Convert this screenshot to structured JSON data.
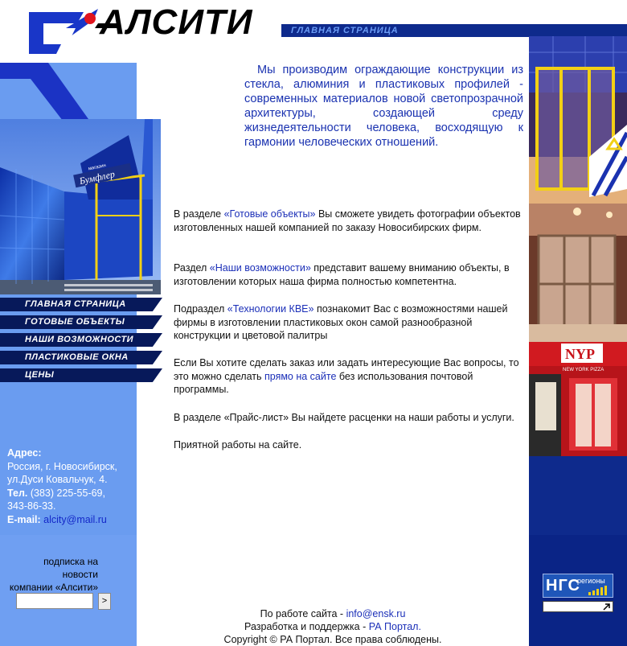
{
  "logo": {
    "text": "АЛСИТИ"
  },
  "header": {
    "section_label": "ГЛАВНАЯ СТРАНИЦА"
  },
  "nav": [
    {
      "label": "ГЛАВНАЯ СТРАНИЦА"
    },
    {
      "label": "ГОТОВЫЕ ОБЪЕКТЫ"
    },
    {
      "label": "НАШИ ВОЗМОЖНОСТИ"
    },
    {
      "label": "ПЛАСТИКОВЫЕ ОКНА"
    },
    {
      "label": "ЦЕНЫ"
    }
  ],
  "photo_main": {
    "sign_text": "Бумфлер",
    "sign_caption": "магазин"
  },
  "intro": "Мы производим ограждающие конструкции из стекла, алюминия и пластиковых профилей - современных материалов новой светопрозрачной архитектуры, создающей среду жизнедеятельности человека, восходящую к гармонии человеческих отношений.",
  "paragraphs": {
    "p1": {
      "pre": "В разделе ",
      "link": "«Готовые объекты»",
      "post": " Вы сможете увидеть фотографии объектов изготовленных нашей компанией по заказу Новосибирских фирм."
    },
    "p2": {
      "pre": "Раздел ",
      "link": "«Наши возможности»",
      "post": " представит вашему вниманию объекты, в изготовлении которых наша фирма полностью компетентна."
    },
    "p3": {
      "pre": "Подраздел ",
      "link": "«Технологии КВЕ»",
      "post": " познакомит Вас с возможностями нашей фирмы в изготовлении пластиковых окон самой разнообразной конструкции и цветовой палитры"
    },
    "p4": {
      "pre": "Если Вы хотите сделать заказ или задать интересующие Вас вопросы, то это можно сделать ",
      "link": "прямо на сайте",
      "post": " без использования почтовой программы."
    },
    "p5": {
      "text": "В разделе «Прайс-лист» Вы найдете расценки на наши работы и услуги."
    },
    "p6": {
      "text": "Приятной работы на сайте."
    }
  },
  "address": {
    "label": "Адрес:",
    "line1": "Россия, г. Новосибирск,",
    "line2": "ул.Дуси Ковальчук, 4.",
    "phone_label": "Тел.",
    "phone1": " (383) 225-55-69,",
    "phone2": "343-86-33.",
    "email_label": "E-mail:",
    "email": "alcity@mail.ru"
  },
  "subscription": {
    "line1": "подписка на",
    "line2": "новости",
    "line3": "компании «Алсити»",
    "input_value": "",
    "button_label": ">"
  },
  "footer": {
    "line1_pre": "По работе сайта - ",
    "line1_link": "info@ensk.ru",
    "line2_pre": "Разработка и поддержка - ",
    "line2_link": "РА Портал.",
    "line3": "Copyright © РА Портал. Все права соблюдены."
  },
  "right_photos": {
    "shop_sign": "NYP",
    "shop_caption": "NEW YORK PIZZA"
  },
  "ngs": {
    "logo": "НГС",
    "sub": "регионы"
  },
  "colors": {
    "dark_blue": "#0e2a8c",
    "light_blue": "#6a9cf0",
    "link": "#1b2fb8",
    "accent_red": "#e0141e"
  }
}
